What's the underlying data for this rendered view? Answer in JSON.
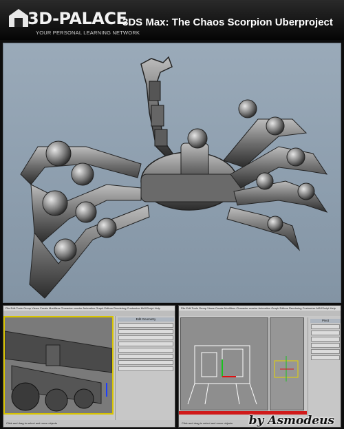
{
  "header": {
    "brand_name": "3D-PALACE",
    "brand_tagline": "YOUR PERSONAL LEARNING NETWORK",
    "title": "3DS Max: The Chaos Scorpion Uberproject"
  },
  "screenshots": {
    "left": {
      "menu": "File  Edit  Tools  Group  Views  Create  Modifiers  Character  reactor  Animation  Graph Editors  Rendering  Customize  MAXScript  Help",
      "panel_title": "Edit Geometry",
      "status": "Click and drag to select and move objects"
    },
    "right": {
      "menu": "File  Edit  Tools  Group  Views  Create  Modifiers  Character  reactor  Animation  Graph Editors  Rendering  Customize  MAXScript  Help",
      "panel_title": "Pivot",
      "status": "Click and drag to select and move objects"
    }
  },
  "signature": "by Asmodeus",
  "colors": {
    "header_bg": "#111111",
    "viewport_bg": "#8fa0b0",
    "model": "#5a5a5a"
  }
}
